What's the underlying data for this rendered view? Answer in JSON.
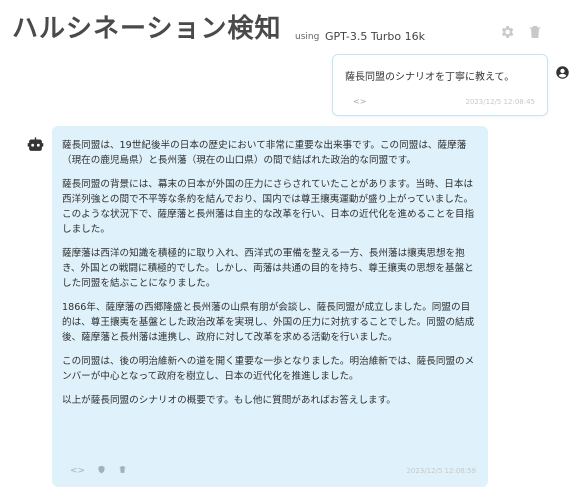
{
  "header": {
    "title": "ハルシネーション検知",
    "using_label": "using",
    "model_name": "GPT-3.5 Turbo 16k",
    "icons": [
      "gear-icon",
      "trash-icon"
    ]
  },
  "user_message": {
    "text": "薩長同盟のシナリオを丁寧に教えて。",
    "code_label": "<>",
    "timestamp": "2023/12/5 12:08:45"
  },
  "assistant_message": {
    "paragraphs": [
      "薩長同盟は、19世紀後半の日本の歴史において非常に重要な出来事です。この同盟は、薩摩藩（現在の鹿児島県）と長州藩（現在の山口県）の間で結ばれた政治的な同盟です。",
      "薩長同盟の背景には、幕末の日本が外国の圧力にさらされていたことがあります。当時、日本は西洋列強との間で不平等な条約を結んでおり、国内では尊王攘夷運動が盛り上がっていました。このような状況下で、薩摩藩と長州藩は自主的な改革を行い、日本の近代化を進めることを目指しました。",
      "薩摩藩は西洋の知識を積極的に取り入れ、西洋式の軍備を整える一方、長州藩は攘夷思想を抱き、外国との戦闘に積極的でした。しかし、両藩は共通の目的を持ち、尊王攘夷の思想を基盤とした同盟を結ぶことになりました。",
      "1866年、薩摩藩の西郷隆盛と長州藩の山県有朋が会談し、薩長同盟が成立しました。同盟の目的は、尊王攘夷を基盤とした政治改革を実現し、外国の圧力に対抗することでした。同盟の結成後、薩摩藩と長州藩は連携し、政府に対して改革を求める活動を行いました。",
      "この同盟は、後の明治維新への道を開く重要な一歩となりました。明治維新では、薩長同盟のメンバーが中心となって政府を樹立し、日本の近代化を推進しました。",
      "以上が薩長同盟のシナリオの概要です。もし他に質問があればお答えします。"
    ],
    "code_label": "<>",
    "timestamp": "2023/12/5 12:08:59",
    "footer_icons": [
      "code-icon",
      "shield-icon",
      "trash-icon"
    ]
  }
}
